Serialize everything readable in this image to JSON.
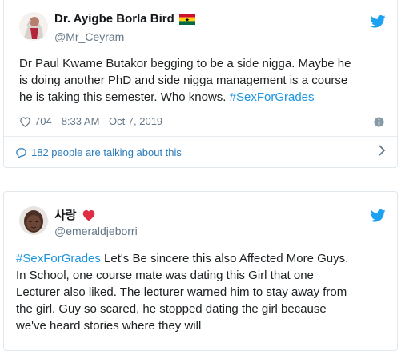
{
  "tweet1": {
    "display_name": "Dr. Ayigbe Borla Bird",
    "handle": "@Mr_Ceyram",
    "text_before": "Dr Paul Kwame Butakor begging to be a side nigga. Maybe he\nis doing another PhD and side nigga management is a course\nhe is taking this semester. Who knows. ",
    "hashtag": "#SexForGrades",
    "likes": "704",
    "timestamp": "8:33 AM - Oct 7, 2019",
    "talking": "182 people are talking about this"
  },
  "tweet2": {
    "display_name": "사랑",
    "handle": "@emeraldjeborri",
    "hashtag": "#SexForGrades",
    "text_after": " Let's Be sincere this also Affected More Guys.\nIn School, one course mate was dating this Girl that one\nLecturer also liked. The lecturer warned him to stay away from\nthe girl. Guy so scared, he stopped dating the girl because\nwe've heard stories where they will"
  },
  "colors": {
    "accent": "#1da1f2",
    "link": "#1b95e0",
    "muted": "#657786"
  },
  "icons": {
    "twitter": "twitter-bird-icon",
    "heart": "heart-outline-icon",
    "info": "info-icon",
    "comment": "speech-bubble-icon",
    "chevron": "chevron-right-icon",
    "flag": "ghana-flag-icon",
    "red_heart": "red-heart-icon"
  }
}
